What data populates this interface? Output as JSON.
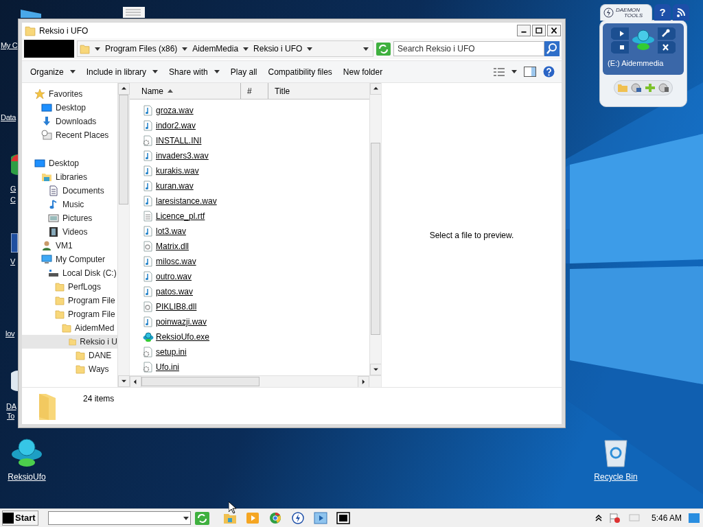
{
  "window": {
    "title": "Reksio i UFO"
  },
  "address": {
    "crumbs": [
      "Program Files (x86)",
      "AidemMedia",
      "Reksio i UFO"
    ]
  },
  "search": {
    "placeholder": "Search Reksio i UFO"
  },
  "toolbar": [
    {
      "label": "Organize",
      "menu": true
    },
    {
      "label": "Include in library",
      "menu": true
    },
    {
      "label": "Share with",
      "menu": true
    },
    {
      "label": "Play all",
      "menu": false
    },
    {
      "label": "Compatibility files",
      "menu": false
    },
    {
      "label": "New folder",
      "menu": false
    }
  ],
  "nav": [
    {
      "label": "Favorites",
      "kind": "star",
      "selected": false,
      "children": [
        {
          "label": "Desktop",
          "kind": "desktop",
          "selected": false
        },
        {
          "label": "Downloads",
          "kind": "download",
          "selected": false
        },
        {
          "label": "Recent Places",
          "kind": "recent",
          "selected": false
        }
      ]
    },
    {
      "label": "Desktop",
      "kind": "desktop",
      "selected": false,
      "children": [
        {
          "label": "Libraries",
          "kind": "library",
          "selected": false,
          "children": [
            {
              "label": "Documents",
              "kind": "document",
              "selected": false
            },
            {
              "label": "Music",
              "kind": "music",
              "selected": false
            },
            {
              "label": "Pictures",
              "kind": "pictures",
              "selected": false
            },
            {
              "label": "Videos",
              "kind": "video",
              "selected": false
            }
          ]
        },
        {
          "label": "VM1",
          "kind": "user",
          "selected": false
        },
        {
          "label": "My Computer",
          "kind": "computer",
          "selected": false,
          "children": [
            {
              "label": "Local Disk (C:)",
              "kind": "disk",
              "selected": false,
              "children": [
                {
                  "label": "PerfLogs",
                  "kind": "folder",
                  "selected": false
                },
                {
                  "label": "Program File",
                  "kind": "folder",
                  "selected": false
                },
                {
                  "label": "Program File",
                  "kind": "folder",
                  "selected": false,
                  "children": [
                    {
                      "label": "AidemMed",
                      "kind": "folder",
                      "selected": false,
                      "children": [
                        {
                          "label": "Reksio i U",
                          "kind": "folder",
                          "selected": true,
                          "children": [
                            {
                              "label": "DANE",
                              "kind": "folder",
                              "selected": false
                            },
                            {
                              "label": "Ways",
                              "kind": "folder",
                              "selected": false
                            }
                          ]
                        }
                      ]
                    }
                  ]
                }
              ]
            }
          ]
        }
      ]
    }
  ],
  "columns": [
    {
      "label": "Name",
      "sorted": true
    },
    {
      "label": "#",
      "sorted": false
    },
    {
      "label": "Title",
      "sorted": false
    }
  ],
  "files": [
    {
      "name": "groza.wav",
      "kind": "audio"
    },
    {
      "name": "indor2.wav",
      "kind": "audio"
    },
    {
      "name": "INSTALL.INI",
      "kind": "settings"
    },
    {
      "name": "invaders3.wav",
      "kind": "audio"
    },
    {
      "name": "kurakis.wav",
      "kind": "audio"
    },
    {
      "name": "kuran.wav",
      "kind": "audio"
    },
    {
      "name": "laresistance.wav",
      "kind": "audio"
    },
    {
      "name": "Licence_pl.rtf",
      "kind": "text"
    },
    {
      "name": "lot3.wav",
      "kind": "audio"
    },
    {
      "name": "Matrix.dll",
      "kind": "dll"
    },
    {
      "name": "milosc.wav",
      "kind": "audio"
    },
    {
      "name": "outro.wav",
      "kind": "audio"
    },
    {
      "name": "patos.wav",
      "kind": "audio"
    },
    {
      "name": "PIKLIB8.dll",
      "kind": "dll"
    },
    {
      "name": "poinwazji.wav",
      "kind": "audio"
    },
    {
      "name": "ReksioUfo.exe",
      "kind": "exe"
    },
    {
      "name": "setup.ini",
      "kind": "settings"
    },
    {
      "name": "Ufo.ini",
      "kind": "settings"
    }
  ],
  "preview": {
    "message": "Select a file to preview."
  },
  "details": {
    "count": "24 items"
  },
  "desktop_icons": [
    {
      "label": "ReksioUfo",
      "kind": "ufo"
    },
    {
      "label": "Recycle Bin",
      "kind": "bin"
    }
  ],
  "desktop_cut_labels": [
    "My C",
    "Data",
    "G",
    "C",
    "V",
    "lov",
    "DA",
    "To"
  ],
  "daemon": {
    "brand": [
      "DAEMON",
      "TOOLS"
    ],
    "help": "?",
    "drive": "(E:) Aidemmedia"
  },
  "taskbar": {
    "start": "Start",
    "clock": "5:46 AM"
  }
}
